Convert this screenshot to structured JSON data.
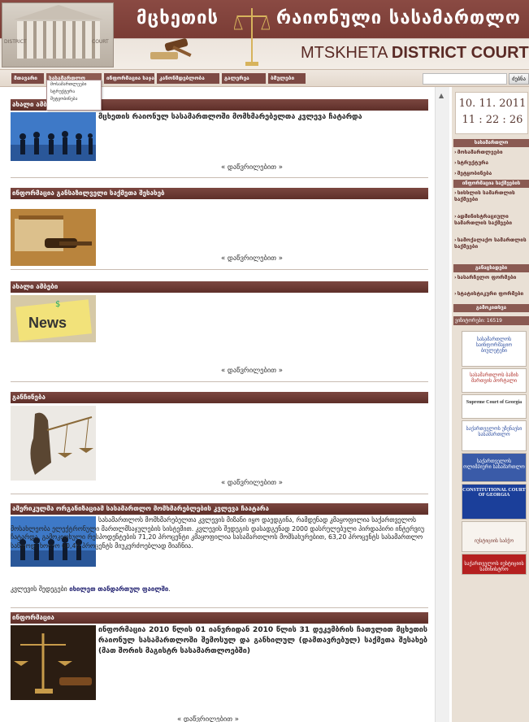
{
  "header": {
    "title_geo_left": "მცხეთის",
    "title_geo_right": "რაიონული სასამართლო",
    "title_en_light": "MTSKHETA ",
    "title_en_bold": "DISTRICT COURT",
    "court_sign_left": "DISTRICT",
    "court_sign_right": "COURT"
  },
  "nav": {
    "items": [
      "მთავარი",
      "სასამართლო",
      "ინფორმაცია საჯარო",
      "კანონმდებლობა",
      "გალერეა",
      "ბმულები"
    ],
    "dropdown": [
      "მოსამართლეები",
      "სტრუქტურა",
      "შეტყობინება"
    ],
    "search_placeholder": "",
    "search_button": "ძებნა"
  },
  "sections": [
    {
      "bar": "ახალი ამბები",
      "headline": "მცხეთის რაიონულ სასამართლოში მომხმარებელთა კვლევა ჩატარდა",
      "more": "« დაწვრილებით »"
    },
    {
      "bar": "ინფორმაცია განსაზილველი საქმეთა შესახებ",
      "headline": "",
      "more": "« დაწვრილებით »"
    },
    {
      "bar": "ახალი ამბები",
      "headline": "",
      "more": "« დაწვრილებით »",
      "thumb_label": "News"
    },
    {
      "bar": "განჩინება",
      "headline": "",
      "more": "« დაწვრილებით »"
    },
    {
      "bar": "ამერიკულმა ორგანიზაციამ სასამართლო მომხმარებლების კვლევა ჩაატარა",
      "body": "სასამართლოს მომხმარებელთა კვლევის მიზანი იყო დაედგინა, რამდენად კმაყოფილია საქართველოს მოსახლეობა ელექტრონული მართლმსაჯულების სისტემით. კვლევის შედეგის დასადგენად 2000 დასრულებული პირდაპირი ინტერვიუ ჩატარდა. გამოკითხული რესპოდენტების 71,20 პროცენტი კმაყოფილია სასამართლოს მომსახურებით, 63,20 პროცენტს სასამართლო სანდოდ, ხოლო 60,40 პროცენტს მიუკერძოებლად მიაჩნია.",
      "body_tail_prefix": "კვლევის შედეგები ",
      "body_tail_link": "იხილეთ თანდართულ ფაილში",
      "body_tail_suffix": "."
    },
    {
      "bar": "ინფორმაცია",
      "headline": "ინფორმაცია 2010 წლის 01 იანვრიდან 2010 წლის 31 დეკემბრის ჩათვლით მცხეთის რაიონულ სასამართლოში შემოსულ და განხილულ (დამთავრებულ) საქმეთა შესახებ (მათ შორის მაგისტრ სასამართლოებში)",
      "more": "« დაწვრილებით »"
    }
  ],
  "sidebar": {
    "date": "10. 11. 2011",
    "time": "11 : 22 : 26",
    "head_court": "სასამართლო",
    "links_court": [
      "მოსამართლეები",
      "სტრუქტურა",
      "შეტყობინება"
    ],
    "head_public": "ინფორმაცია საქმეების",
    "links_public": [
      "სისხლის სამართლის საქმეები",
      "ადმინისტრაციული სამართლის საქმეები",
      "სამოქალაქო სამართლის საქმეები"
    ],
    "head_docs": "განაცხადები",
    "links_docs": [
      "სასარჩელო ფორმები",
      "სტატისტიკური ფორმები"
    ],
    "head_poll": "გამოკითხვა",
    "visitors": "ვიზიტორები: 16519",
    "banners": [
      "სასამართლოს საინფორმაციო ბიულეტენი",
      "სასამართლოს ბაზის მართვის პორტალი",
      "Supreme Court of Georgia",
      "საქართველოს უზენაესი სასამართლო",
      "საქართველოს ოლიმპიური სასამართლო",
      "CONSTITUTIONAL COURT OF GEORGIA",
      "იუსტიციის საბჭო",
      "საქართველოს იუსტიციის სამინისტრო"
    ]
  },
  "colors": {
    "brand": "#7a3c35",
    "bar": "#6a3832",
    "sidebar_bg": "#e9e0d5"
  }
}
